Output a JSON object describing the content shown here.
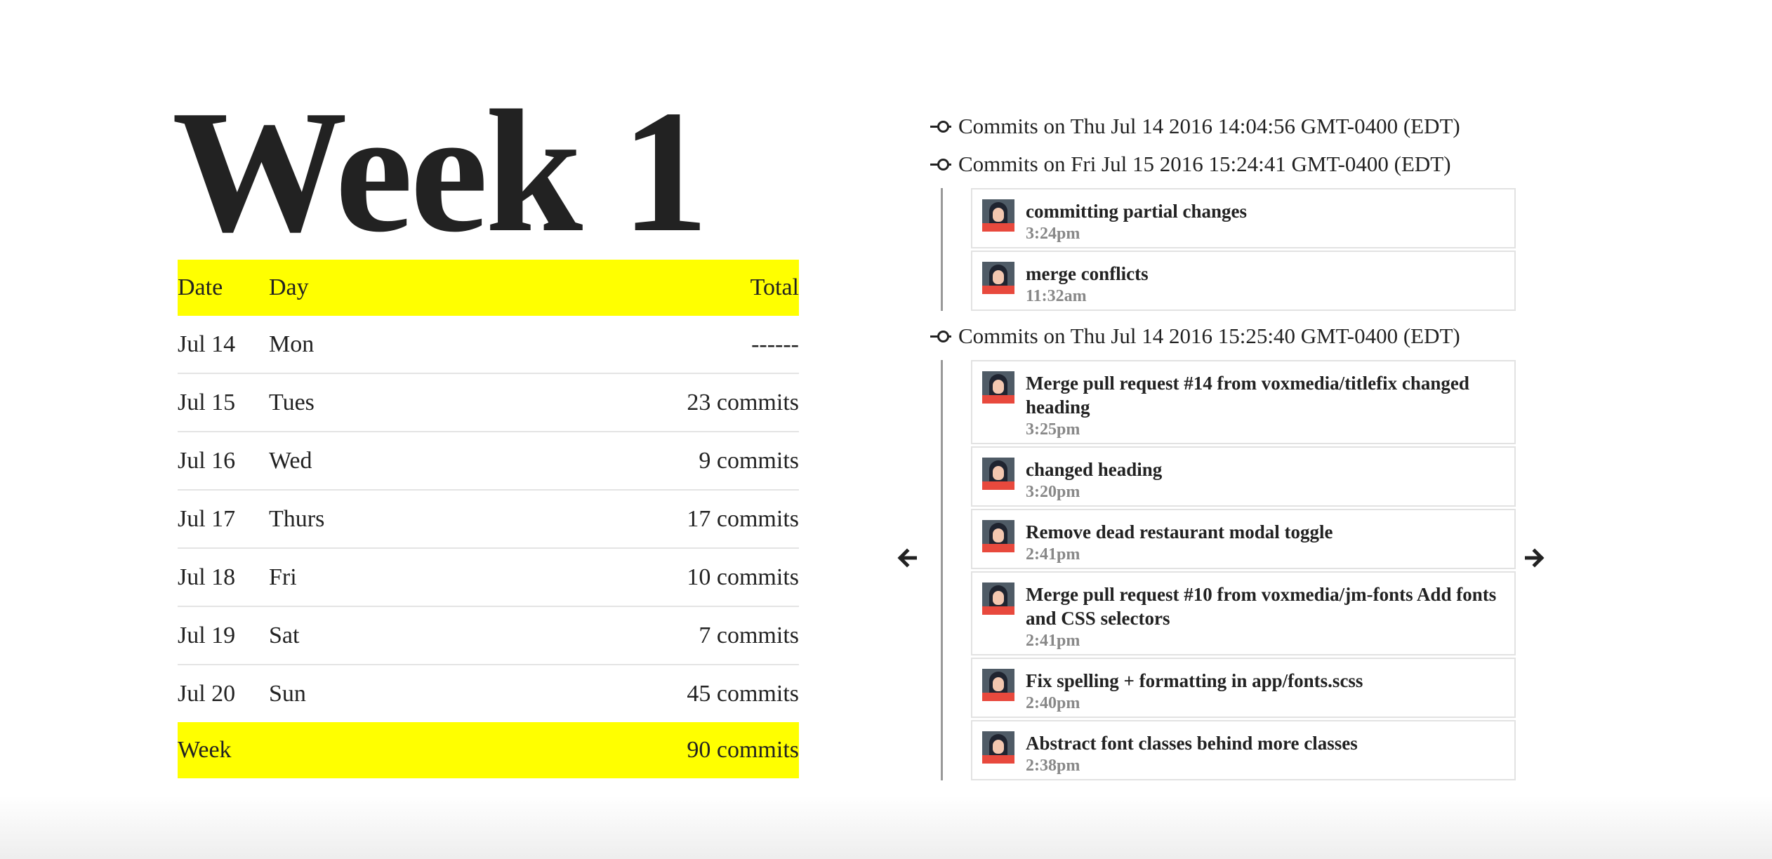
{
  "week": {
    "title": "Week 1",
    "table": {
      "headers": {
        "date": "Date",
        "day": "Day",
        "total": "Total"
      },
      "rows": [
        {
          "date": "Jul 14",
          "day": "Mon",
          "total": "------"
        },
        {
          "date": "Jul 15",
          "day": "Tues",
          "total": "23 commits"
        },
        {
          "date": "Jul 16",
          "day": "Wed",
          "total": "9 commits"
        },
        {
          "date": "Jul 17",
          "day": "Thurs",
          "total": "17 commits"
        },
        {
          "date": "Jul 18",
          "day": "Fri",
          "total": "10 commits"
        },
        {
          "date": "Jul 19",
          "day": "Sat",
          "total": "7 commits"
        },
        {
          "date": "Jul 20",
          "day": "Sun",
          "total": "45 commits"
        }
      ],
      "footer": {
        "label": "Week",
        "total": "90 commits"
      },
      "highlight_color": "#ffff00"
    }
  },
  "commits": {
    "groups": [
      {
        "heading": "Commits on Thu Jul 14 2016 14:04:56 GMT-0400 (EDT)",
        "items": []
      },
      {
        "heading": "Commits on Fri Jul 15 2016 15:24:41 GMT-0400 (EDT)",
        "items": [
          {
            "message": "committing partial changes",
            "time": "3:24pm"
          },
          {
            "message": "merge conflicts",
            "time": "11:32am"
          }
        ]
      },
      {
        "heading": "Commits on Thu Jul 14 2016 15:25:40 GMT-0400 (EDT)",
        "items": [
          {
            "message": "Merge pull request #14 from voxmedia/titlefix changed heading",
            "time": "3:25pm"
          },
          {
            "message": "changed heading",
            "time": "3:20pm"
          },
          {
            "message": "Remove dead restaurant modal toggle",
            "time": "2:41pm"
          },
          {
            "message": "Merge pull request #10 from voxmedia/jm-fonts Add fonts and CSS selectors",
            "time": "2:41pm"
          },
          {
            "message": "Fix spelling + formatting in app/fonts.scss",
            "time": "2:40pm"
          },
          {
            "message": "Abstract font classes behind more classes",
            "time": "2:38pm"
          }
        ]
      }
    ]
  },
  "nav": {
    "prev_icon": "arrow-left-icon",
    "next_icon": "arrow-right-icon"
  }
}
